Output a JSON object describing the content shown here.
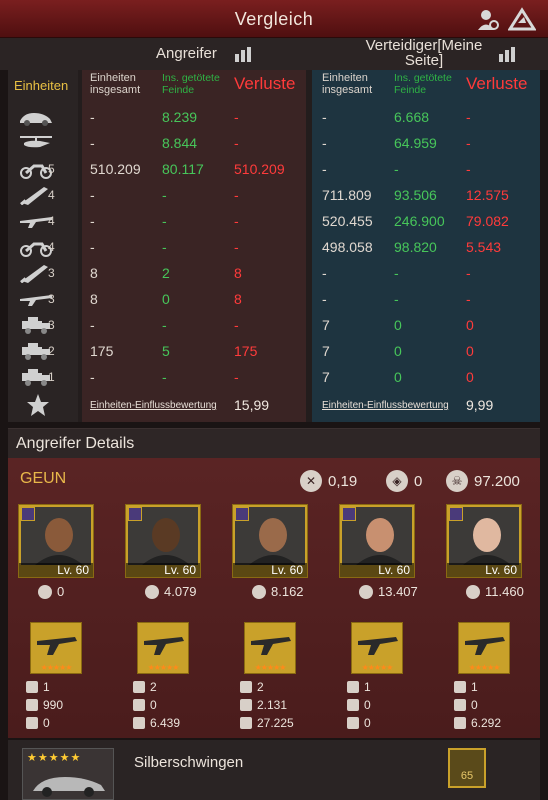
{
  "window": {
    "title": "Vergleich"
  },
  "subheader": {
    "attacker": "Angreifer",
    "defender": "Verteidiger[Meine Seite]"
  },
  "table": {
    "headers": {
      "units": "Einheiten",
      "total": "Einheiten insgesamt",
      "killed": "Ins. getötete Feinde",
      "losses": "Verluste"
    },
    "rows": [
      {
        "icon": "car-icon",
        "tier": "",
        "att": [
          "-",
          "8.239",
          "-"
        ],
        "def": [
          "-",
          "6.668",
          "-"
        ]
      },
      {
        "icon": "helicopter-icon",
        "tier": "",
        "att": [
          "-",
          "8.844",
          "-"
        ],
        "def": [
          "-",
          "64.959",
          "-"
        ]
      },
      {
        "icon": "motorcycle-icon",
        "tier": "5",
        "att": [
          "510.209",
          "80.117",
          "510.209"
        ],
        "def": [
          "-",
          "-",
          "-"
        ]
      },
      {
        "icon": "blade-icon",
        "tier": "4",
        "att": [
          "-",
          "-",
          "-"
        ],
        "def": [
          "711.809",
          "93.506",
          "12.575"
        ]
      },
      {
        "icon": "rifle-icon",
        "tier": "4",
        "att": [
          "-",
          "-",
          "-"
        ],
        "def": [
          "520.455",
          "246.900",
          "79.082"
        ]
      },
      {
        "icon": "motorcycle-icon",
        "tier": "4",
        "att": [
          "-",
          "-",
          "-"
        ],
        "def": [
          "498.058",
          "98.820",
          "5.543"
        ]
      },
      {
        "icon": "blade-icon",
        "tier": "3",
        "att": [
          "8",
          "2",
          "8"
        ],
        "def": [
          "-",
          "-",
          "-"
        ]
      },
      {
        "icon": "rifle-icon",
        "tier": "3",
        "att": [
          "8",
          "0",
          "8"
        ],
        "def": [
          "-",
          "-",
          "-"
        ]
      },
      {
        "icon": "truck-icon",
        "tier": "3",
        "att": [
          "-",
          "-",
          "-"
        ],
        "def": [
          "7",
          "0",
          "0"
        ]
      },
      {
        "icon": "truck-icon",
        "tier": "2",
        "att": [
          "175",
          "5",
          "175"
        ],
        "def": [
          "7",
          "0",
          "0"
        ]
      },
      {
        "icon": "truck-icon",
        "tier": "1",
        "att": [
          "-",
          "-",
          "-"
        ],
        "def": [
          "7",
          "0",
          "0"
        ]
      }
    ],
    "score_label": "Einheiten-Einflussbewertung",
    "att_score": "15,99",
    "def_score": "9,99"
  },
  "details": {
    "title": "Angreifer Details",
    "player": "GEUN",
    "stats": [
      "0,19",
      "0",
      "97.200"
    ],
    "heroes": [
      {
        "level": "Lv. 60",
        "power": "0"
      },
      {
        "level": "Lv. 60",
        "power": "4.079"
      },
      {
        "level": "Lv. 60",
        "power": "8.162"
      },
      {
        "level": "Lv. 60",
        "power": "13.407"
      },
      {
        "level": "Lv. 60",
        "power": "11.460"
      }
    ],
    "weapons": [
      {
        "stars": "★★★★★",
        "a": "1",
        "b": "990",
        "c": "0"
      },
      {
        "stars": "★★★★★",
        "a": "2",
        "b": "0",
        "c": "6.439"
      },
      {
        "stars": "★★★★★",
        "a": "2",
        "b": "2.131",
        "c": "27.225"
      },
      {
        "stars": "★★★★★",
        "a": "1",
        "b": "0",
        "c": "0"
      },
      {
        "stars": "★★★★★",
        "a": "1",
        "b": "0",
        "c": "6.292"
      }
    ]
  },
  "vehicle": {
    "stars": "★★★★★",
    "name": "Silberschwingen",
    "rank": "65"
  }
}
